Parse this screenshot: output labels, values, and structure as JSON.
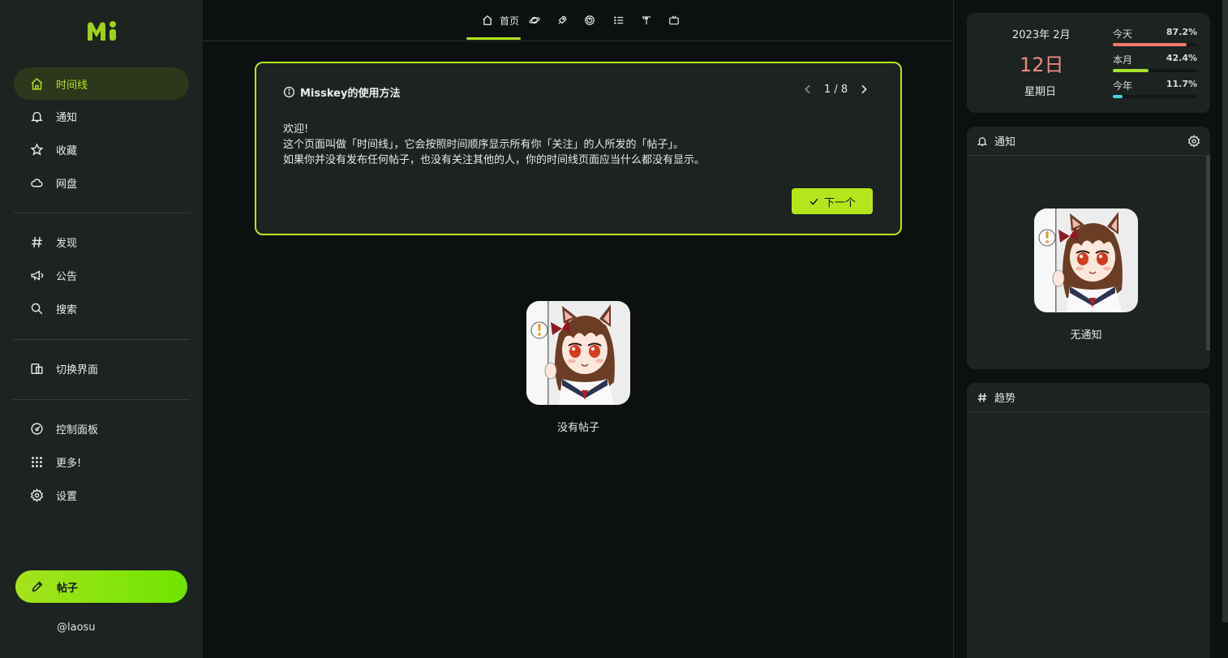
{
  "app": {
    "logo_text": "Mi"
  },
  "sidebar": {
    "items": [
      {
        "label": "时间线",
        "icon": "home-icon"
      },
      {
        "label": "通知",
        "icon": "bell-icon"
      },
      {
        "label": "收藏",
        "icon": "star-icon"
      },
      {
        "label": "网盘",
        "icon": "cloud-icon"
      },
      {
        "label": "发现",
        "icon": "hash-icon"
      },
      {
        "label": "公告",
        "icon": "megaphone-icon"
      },
      {
        "label": "搜索",
        "icon": "search-icon"
      },
      {
        "label": "切换界面",
        "icon": "switch-ui-icon"
      },
      {
        "label": "控制面板",
        "icon": "gauge-icon"
      },
      {
        "label": "更多!",
        "icon": "grid-dots-icon"
      },
      {
        "label": "设置",
        "icon": "gear-icon"
      }
    ],
    "post_button": "帖子",
    "account": "@laosu"
  },
  "tabs": {
    "home_label": "首页",
    "icons": [
      "home-icon",
      "planet-icon",
      "rocket-icon",
      "whirl-icon",
      "list-icon",
      "antenna-icon",
      "tv-icon"
    ]
  },
  "onboarding": {
    "title": "Misskey的使用方法",
    "page": "1 / 8",
    "lines": [
      "欢迎!",
      "这个页面叫做「时间线」，它会按照时间顺序显示所有你「关注」的人所发的「帖子」。",
      "如果你并没有发布任何帖子，也没有关注其他的人，你的时间线页面应当什么都没有显示。"
    ],
    "next_button": "下一个"
  },
  "timeline": {
    "empty_text": "没有帖子"
  },
  "calendar": {
    "year_month": "2023年  2月",
    "day": "12日",
    "weekday": "星期日",
    "progress": [
      {
        "label": "今天",
        "percent": "87.2%",
        "value": 0.872,
        "color": "#f07a6e"
      },
      {
        "label": "本月",
        "percent": "42.4%",
        "value": 0.424,
        "color": "#a6e22e"
      },
      {
        "label": "今年",
        "percent": "11.7%",
        "value": 0.117,
        "color": "#4dd0e1"
      }
    ]
  },
  "notifications_widget": {
    "title": "通知",
    "empty_text": "无通知"
  },
  "trends_widget": {
    "title": "趋势"
  },
  "colors": {
    "accent": "#b5e61d",
    "sidebar_bg": "#1c2321",
    "page_bg": "#0c1110"
  }
}
